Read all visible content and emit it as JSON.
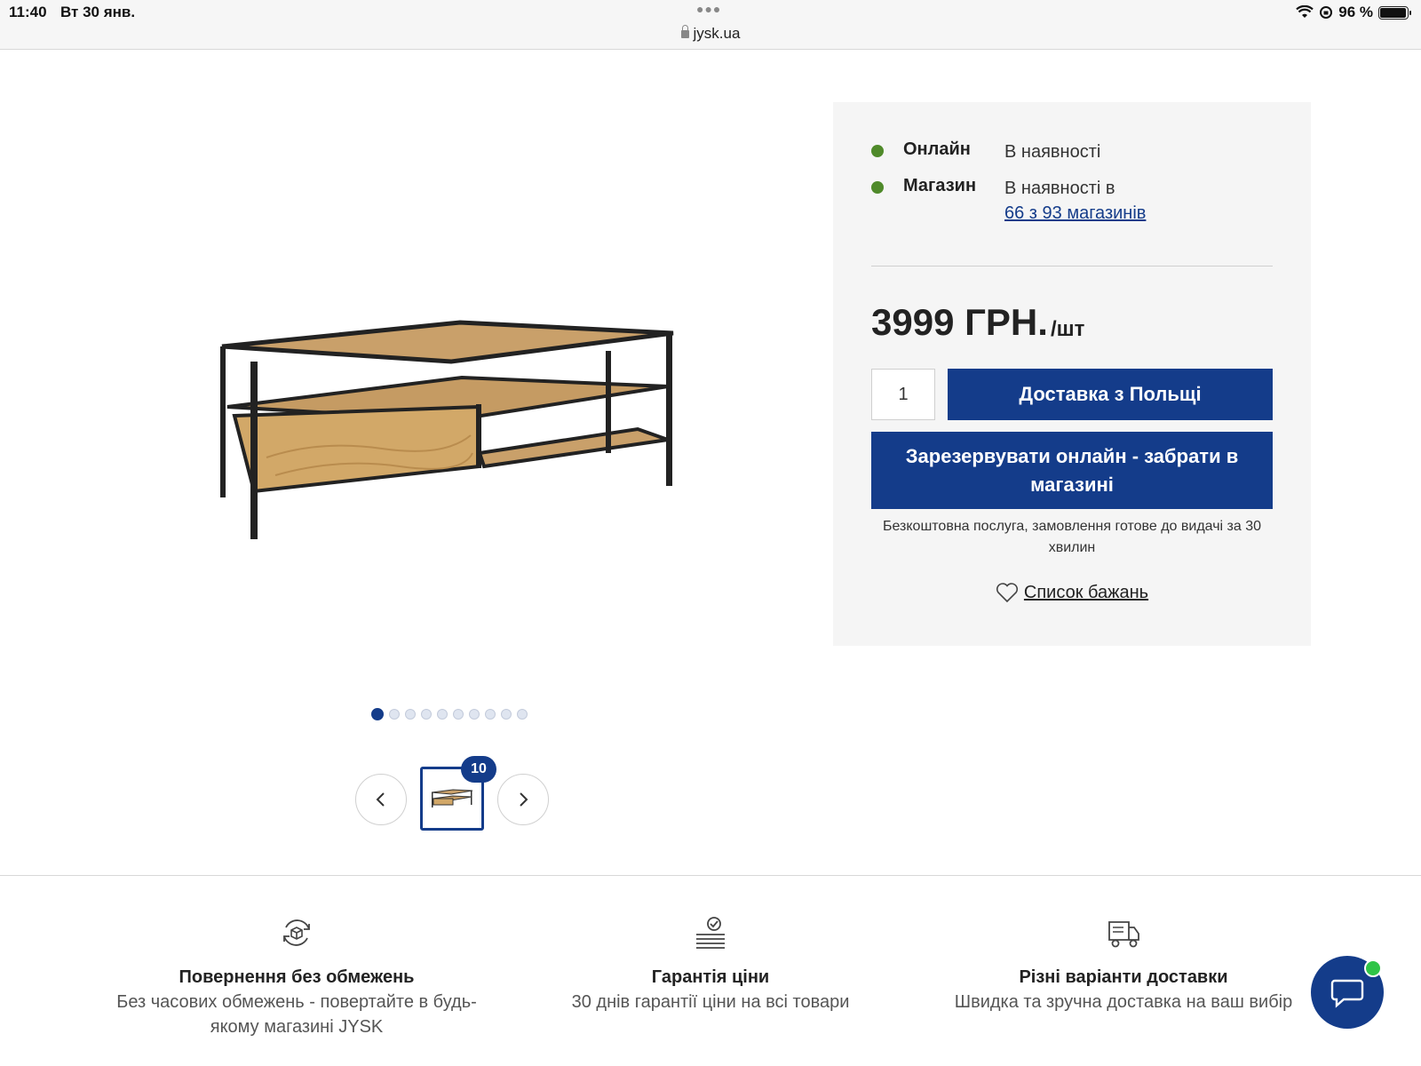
{
  "status_bar": {
    "time": "11:40",
    "date": "Вт 30 янв.",
    "url": "jysk.ua",
    "battery": "96 %"
  },
  "gallery": {
    "image_count": 10,
    "active_index": 0,
    "thumbnail_badge": "10"
  },
  "availability": {
    "online": {
      "label": "Онлайн",
      "status": "В наявності"
    },
    "store": {
      "label": "Магазин",
      "status": "В наявності в",
      "link": "66 з 93 магазинів"
    }
  },
  "price": {
    "amount": "3999 ГРН.",
    "unit": "/шт"
  },
  "purchase": {
    "quantity": "1",
    "delivery_button": "Доставка з Польщі",
    "reserve_button": "Зарезервувати онлайн - забрати в магазині",
    "reserve_note": "Безкоштовна послуга, замовлення готове до видачі за 30 хвилин",
    "wishlist": "Список бажань"
  },
  "features": [
    {
      "icon": "return-box-icon",
      "title": "Повернення без обмежень",
      "desc": "Без часових обмежень - повертайте в будь-якому магазині JYSK"
    },
    {
      "icon": "price-guarantee-icon",
      "title": "Гарантія ціни",
      "desc": "30 днів гарантії ціни на всі товари"
    },
    {
      "icon": "delivery-truck-icon",
      "title": "Різні варіанти доставки",
      "desc": "Швидка та зручна доставка на ваш вибір"
    }
  ],
  "colors": {
    "brand_blue": "#143c8a",
    "in_stock_green": "#4f8a2a",
    "chat_online": "#2fc447"
  }
}
